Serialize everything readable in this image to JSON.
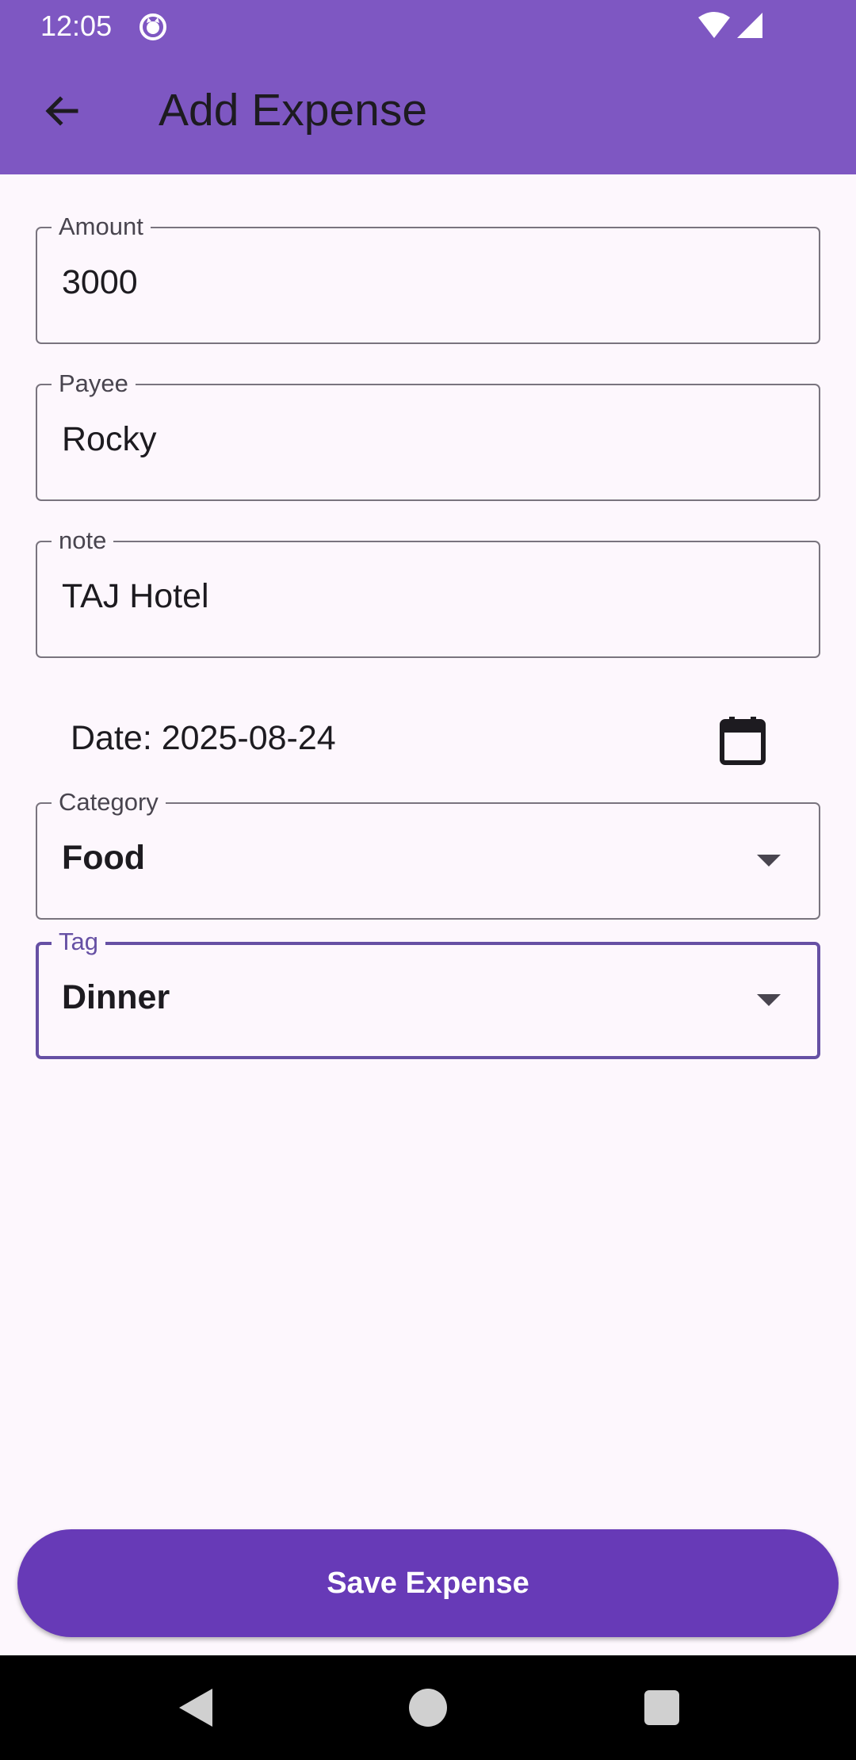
{
  "status_bar": {
    "time": "12:05"
  },
  "app_bar": {
    "title": "Add Expense"
  },
  "form": {
    "amount": {
      "label": "Amount",
      "value": "3000"
    },
    "payee": {
      "label": "Payee",
      "value": "Rocky"
    },
    "note": {
      "label": "note",
      "value": "TAJ Hotel"
    },
    "date": {
      "text": "Date: 2025-08-24"
    },
    "category": {
      "label": "Category",
      "value": "Food"
    },
    "tag": {
      "label": "Tag",
      "value": "Dinner"
    }
  },
  "actions": {
    "save_label": "Save Expense"
  },
  "icons": {
    "back": "arrow-back-icon",
    "calendar": "calendar-icon",
    "dropdown": "arrow-drop-down-icon",
    "wifi": "wifi-icon",
    "signal": "signal-icon"
  },
  "colors": {
    "app_bar": "#7e57c2",
    "primary": "#673ab7",
    "focused_outline": "#6650a4",
    "background": "#fdf7fd"
  }
}
